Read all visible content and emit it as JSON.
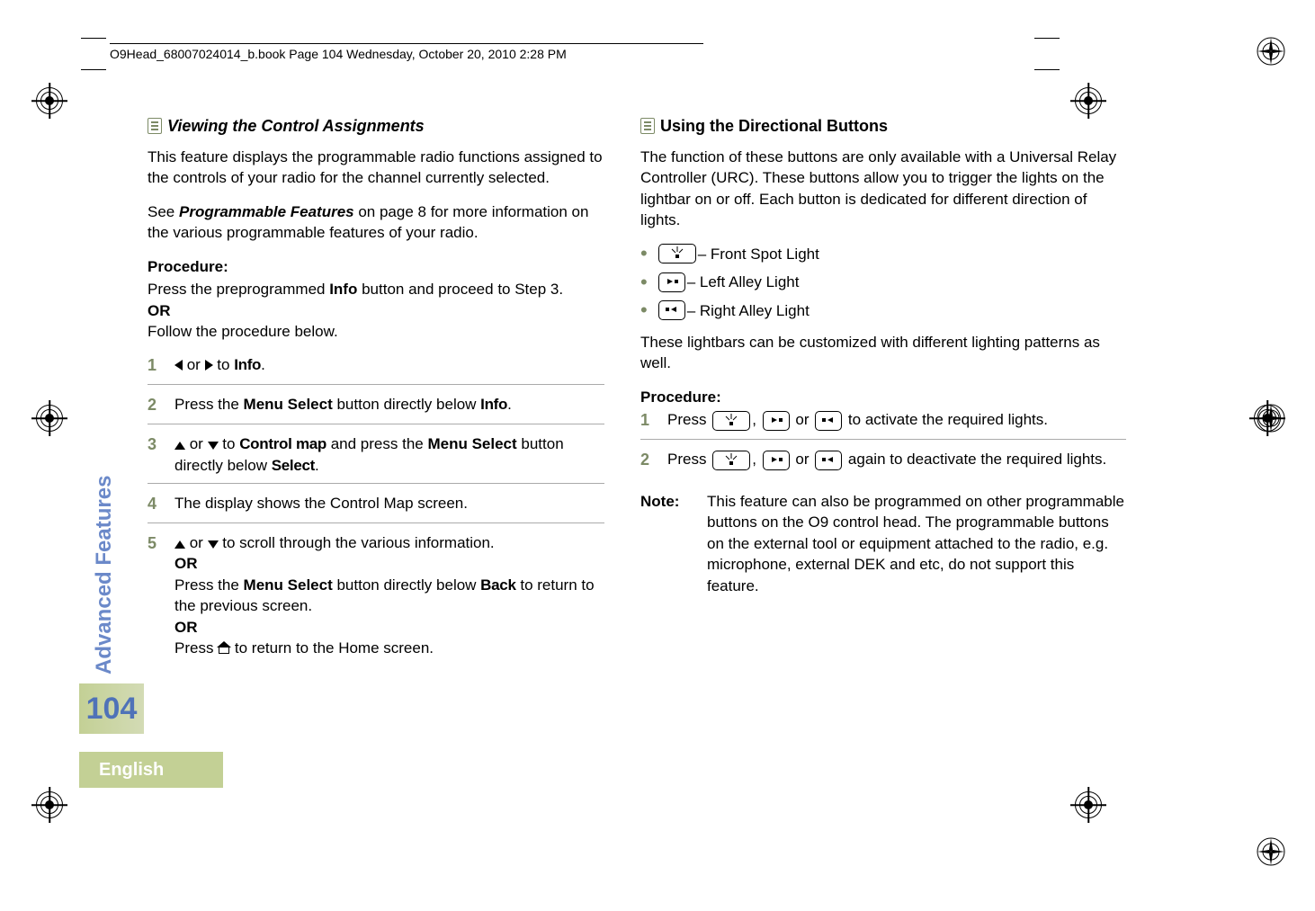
{
  "header_line": "O9Head_68007024014_b.book  Page 104  Wednesday, October 20, 2010  2:28 PM",
  "side_tab": "Advanced Features",
  "page_number": "104",
  "language": "English",
  "left": {
    "heading": "Viewing the Control Assignments",
    "para1": "This feature displays the programmable radio functions assigned to the controls of your radio for the channel currently selected.",
    "para2a": "See ",
    "para2b": "Programmable Features",
    "para2c": " on page 8 for more information on the various programmable features of your radio.",
    "proc": "Procedure:",
    "pretext1": "Press the preprogrammed ",
    "pretext1b": "Info",
    "pretext1c": " button and proceed to Step 3.",
    "or": "OR",
    "pretext2": "Follow the procedure below.",
    "steps": {
      "s1_a": " or ",
      "s1_b": " to ",
      "s1_menu": "Info",
      "s1_c": ".",
      "s2_a": "Press the ",
      "s2_b": "Menu Select",
      "s2_c": " button directly below ",
      "s2_menu": "Info",
      "s2_d": ".",
      "s3_a": " or ",
      "s3_b": " to ",
      "s3_menu": "Control map",
      "s3_c": " and press the ",
      "s3_d": "Menu Select",
      "s3_e": " button directly below ",
      "s3_menu2": "Select",
      "s3_f": ".",
      "s4": "The display shows the Control Map screen.",
      "s5_a": " or ",
      "s5_b": " to scroll through the various information.",
      "s5_or1": "OR",
      "s5_c": "Press the ",
      "s5_d": "Menu Select",
      "s5_e": " button directly below ",
      "s5_menu": "Back",
      "s5_f": " to return to the previous screen.",
      "s5_or2": "OR",
      "s5_g": "Press ",
      "s5_h": " to return to the Home screen."
    },
    "nums": [
      "1",
      "2",
      "3",
      "4",
      "5"
    ]
  },
  "right": {
    "heading": "Using the Directional Buttons",
    "para1": "The function of these buttons are only available with a Universal Relay Controller (URC). These buttons allow you to trigger the lights on the lightbar on or off. Each button is dedicated for different direction of lights.",
    "bullets": {
      "b1": " – Front Spot Light",
      "b2": " – Left Alley Light",
      "b3": " – Right Alley Light"
    },
    "para2": "These lightbars can be customized with different lighting patterns as well.",
    "proc": "Procedure:",
    "steps": {
      "s1_a": "Press ",
      "s1_b": ", ",
      "s1_c": " or ",
      "s1_d": " to activate the required lights.",
      "s2_a": "Press ",
      "s2_b": ", ",
      "s2_c": " or ",
      "s2_d": " again to deactivate the required lights."
    },
    "nums": [
      "1",
      "2"
    ],
    "note_label": "Note:",
    "note_text": "This feature can also be programmed on other programmable buttons on the O9 control head. The programmable buttons on the external tool or equipment attached to the radio, e.g. microphone, external DEK and etc, do not support this feature."
  }
}
